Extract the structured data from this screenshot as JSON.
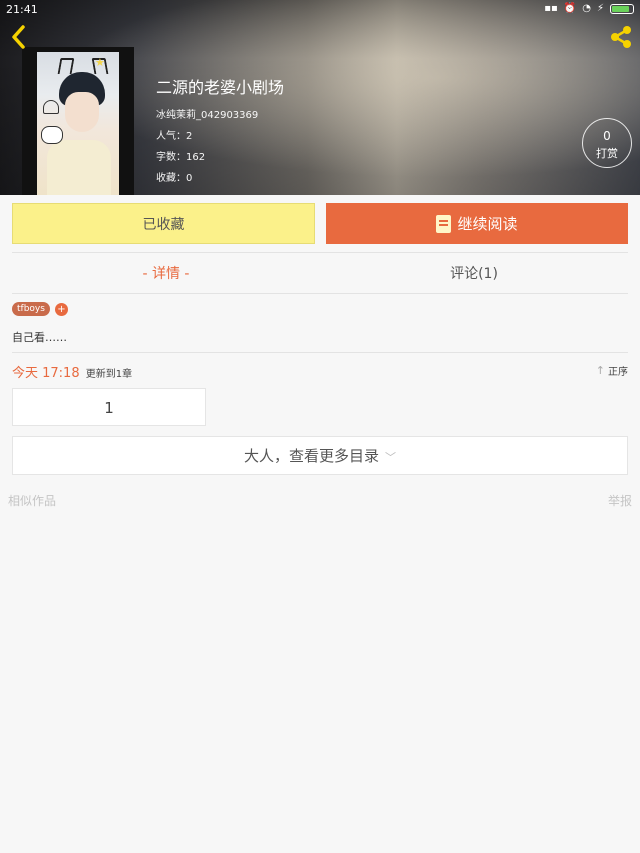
{
  "status_bar": {
    "time": "21:41"
  },
  "book": {
    "title": "二源的老婆小剧场",
    "author": "冰纯茉莉_042903369",
    "popularity": "人气：2",
    "word_count": "字数：162",
    "favorites": "收藏：0"
  },
  "tip": {
    "count": "0",
    "label": "打赏"
  },
  "actions": {
    "collected_label": "已收藏",
    "continue_label": "继续阅读"
  },
  "tabs": [
    {
      "label": "- 详情 -",
      "active": true
    },
    {
      "label": "评论(1)",
      "active": false
    }
  ],
  "tags": [
    "tfboys"
  ],
  "tag_add_label": "+",
  "description": "自己看……",
  "update": {
    "when": "今天 17:18",
    "text": "更新到1章"
  },
  "sort_label": "正序",
  "chapters": [
    "1"
  ],
  "more_label": "大人，查看更多目录",
  "footer": {
    "similar_label": "相似作品",
    "report_label": "举报"
  },
  "colors": {
    "accent": "#e86a3f",
    "collected_bg": "#fbf18a"
  }
}
